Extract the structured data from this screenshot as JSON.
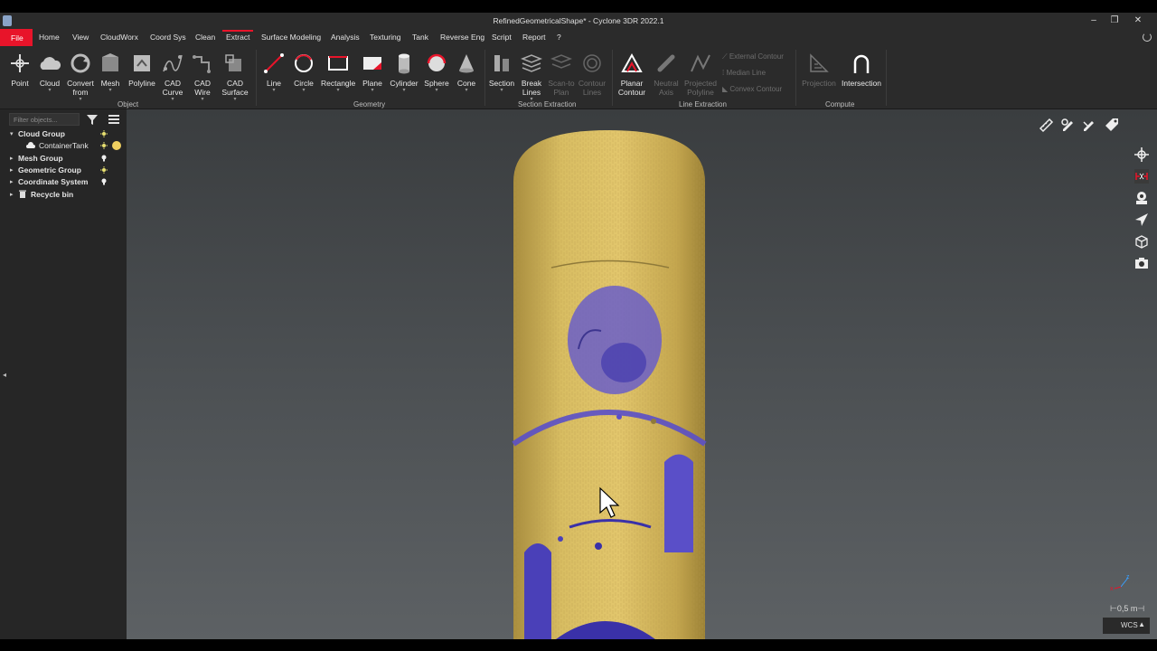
{
  "window": {
    "title": "RefinedGeometricalShape* - Cyclone 3DR 2022.1",
    "minimize": "–",
    "restore": "❐",
    "close": "✕"
  },
  "menu": {
    "file": "File",
    "items": [
      "Home",
      "View",
      "CloudWorx",
      "Coord Sys",
      "Clean",
      "Extract",
      "Surface Modeling",
      "Analysis",
      "Texturing",
      "Tank",
      "Reverse Eng",
      "Script",
      "Report",
      "?"
    ],
    "active": "Extract"
  },
  "ribbon": {
    "object": {
      "label": "Object",
      "point": "Point",
      "cloud": "Cloud",
      "convert": "Convert from",
      "mesh": "Mesh",
      "polyline": "Polyline",
      "cad_curve": "CAD Curve",
      "cad_wire": "CAD Wire",
      "cad_surface": "CAD Surface"
    },
    "geometry": {
      "label": "Geometry",
      "line": "Line",
      "circle": "Circle",
      "rectangle": "Rectangle",
      "plane": "Plane",
      "cylinder": "Cylinder",
      "sphere": "Sphere",
      "cone": "Cone"
    },
    "section_extraction": {
      "label": "Section Extraction",
      "section": "Section",
      "break_lines": "Break Lines",
      "scan_to_plan": "Scan-to Plan",
      "contour_lines": "Contour Lines"
    },
    "line_extraction": {
      "label": "Line Extraction",
      "planar_contour": "Planar Contour",
      "neutral_axis": "Neutral Axis",
      "projected_polyline": "Projected Polyline",
      "external_contour": "External Contour",
      "median_line": "Median Line",
      "convex_contour": "Convex Contour"
    },
    "compute": {
      "label": "Compute",
      "projection": "Projection",
      "intersection": "Intersection"
    }
  },
  "sidebar": {
    "filter_placeholder": "Filter objects...",
    "tree": [
      {
        "label": "Cloud Group",
        "bold": true
      },
      {
        "label": "ContainerTank",
        "bold": false
      },
      {
        "label": "Mesh Group",
        "bold": true
      },
      {
        "label": "Geometric Group",
        "bold": true
      },
      {
        "label": "Coordinate System",
        "bold": true
      },
      {
        "label": "Recycle bin",
        "bold": true
      }
    ]
  },
  "viewport": {
    "scale_label": "⊢0,5 m⊣",
    "coord_system": "WCS",
    "axis_x": "x",
    "axis_z": "z"
  },
  "colors": {
    "accent": "#e8142a",
    "cloud_gold": "#c9a94f",
    "cloud_violet": "#5a4fc8",
    "sun_yellow": "#e8e070"
  }
}
